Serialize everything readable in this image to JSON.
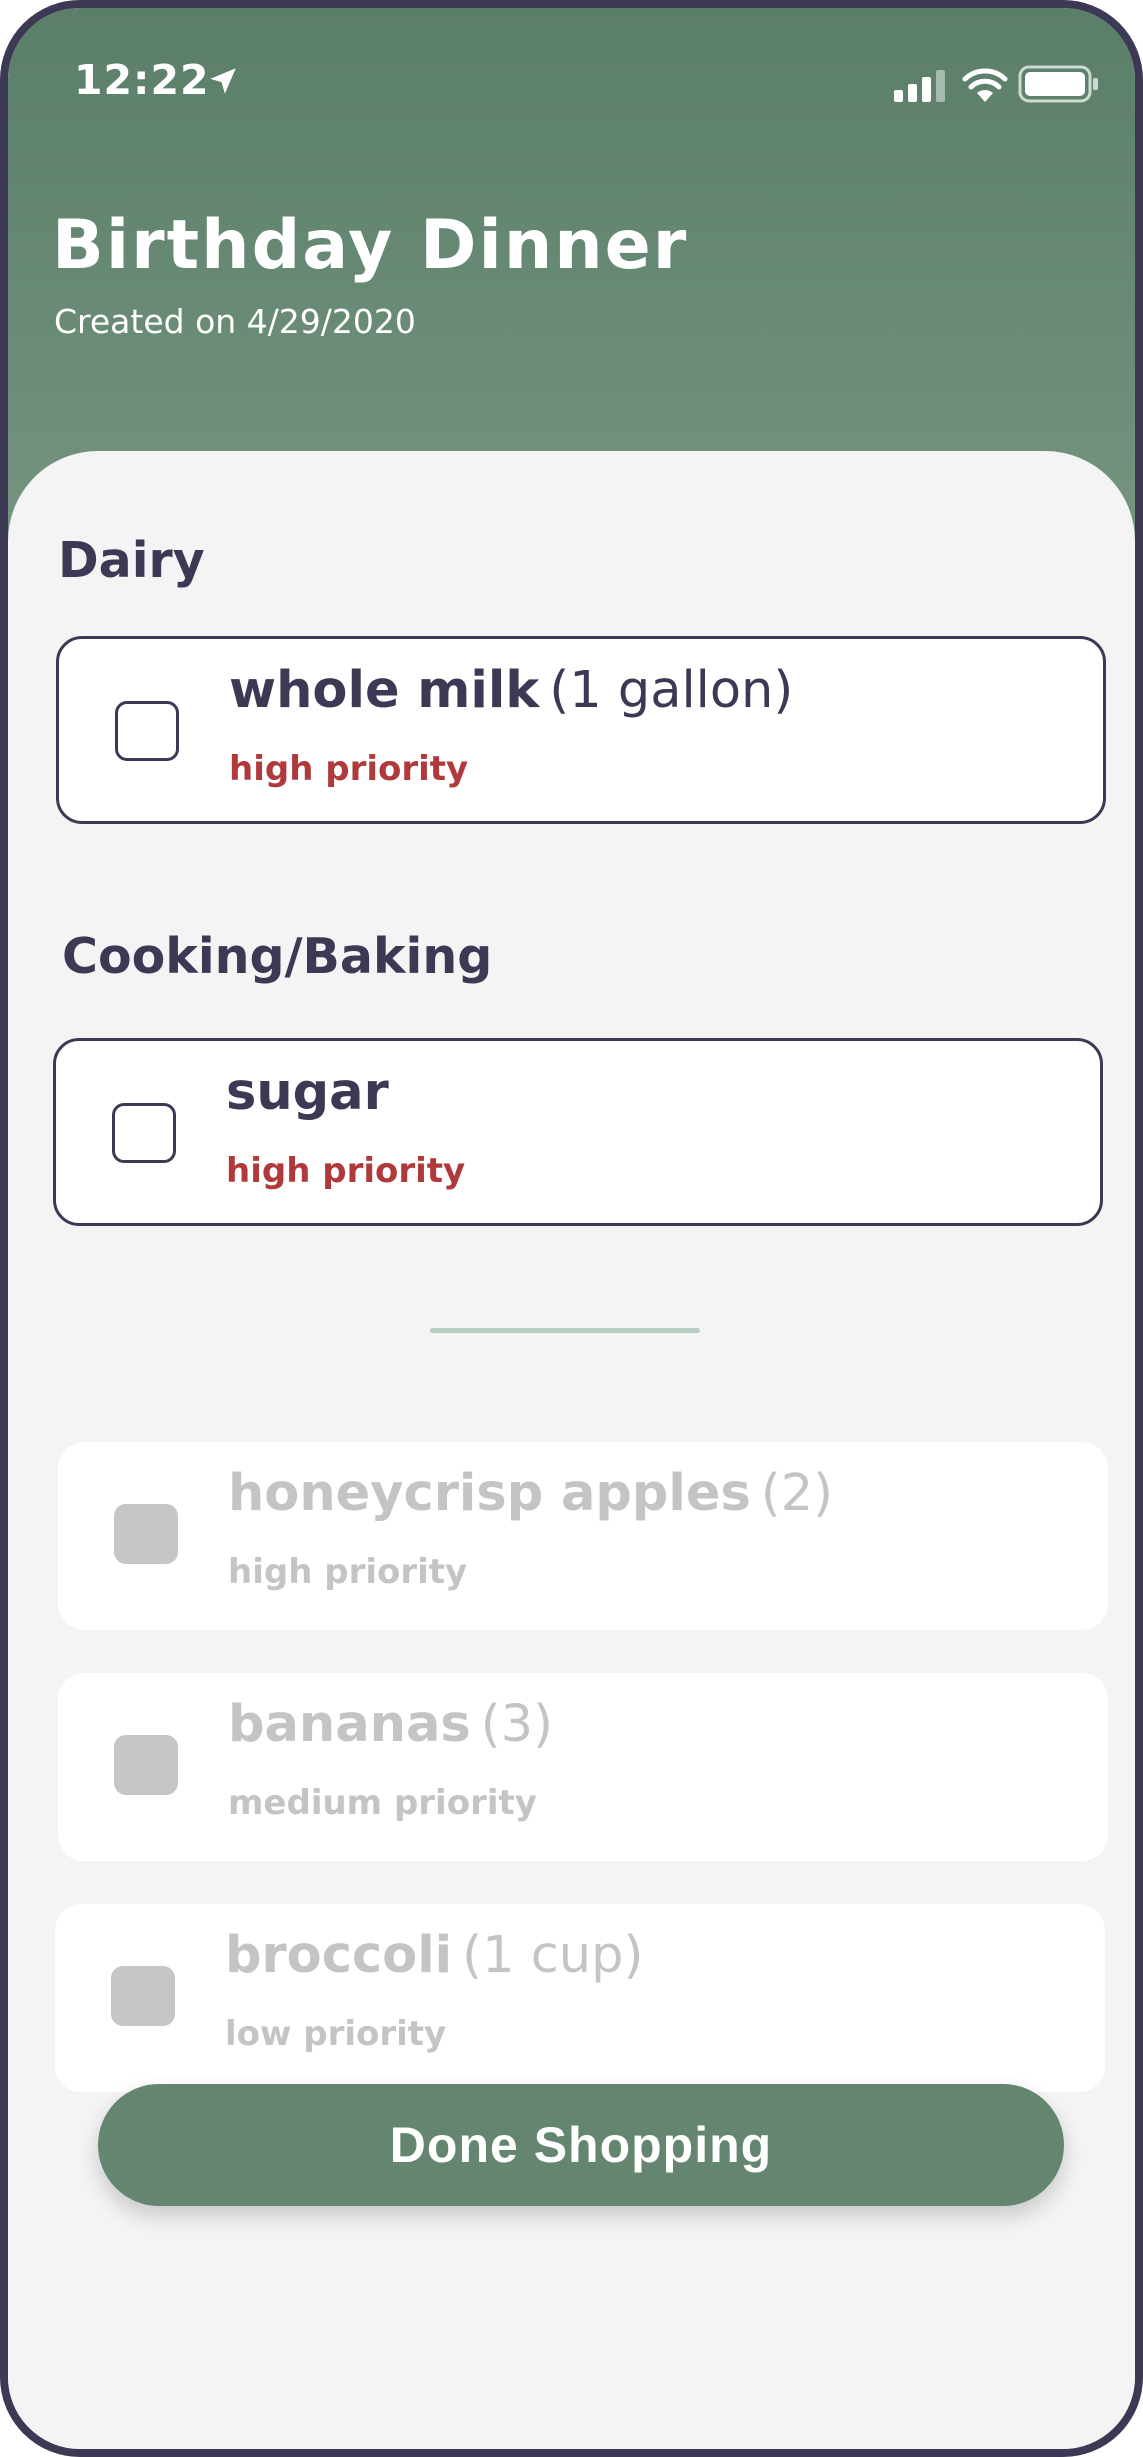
{
  "status_bar": {
    "time": "12:22",
    "icons": [
      "location-arrow-icon",
      "signal-icon",
      "wifi-icon",
      "battery-icon"
    ]
  },
  "header": {
    "title": "Birthday Dinner",
    "subtitle": "Created on 4/29/2020"
  },
  "sections": [
    {
      "title": "Dairy",
      "items": [
        {
          "name": "whole milk",
          "quantity": "(1 gallon)",
          "priority": "high priority",
          "checked": false
        }
      ]
    },
    {
      "title": "Cooking/Baking",
      "items": [
        {
          "name": "sugar",
          "quantity": "",
          "priority": "high priority",
          "checked": false
        }
      ]
    }
  ],
  "completed_items": [
    {
      "name": "honeycrisp apples",
      "quantity": "(2)",
      "priority": "high priority",
      "checked": true
    },
    {
      "name": "bananas",
      "quantity": "(3)",
      "priority": "medium priority",
      "checked": true
    },
    {
      "name": "broccoli",
      "quantity": "(1 cup)",
      "priority": "low priority",
      "checked": true
    }
  ],
  "footer": {
    "done_button_label": "Done Shopping"
  },
  "colors": {
    "header_green": "#5b7e69",
    "button_green": "#64856f",
    "ink": "#3b3954",
    "priority_red": "#b0393b",
    "muted_gray": "#c4c4c4",
    "background": "#f4f4f4"
  }
}
